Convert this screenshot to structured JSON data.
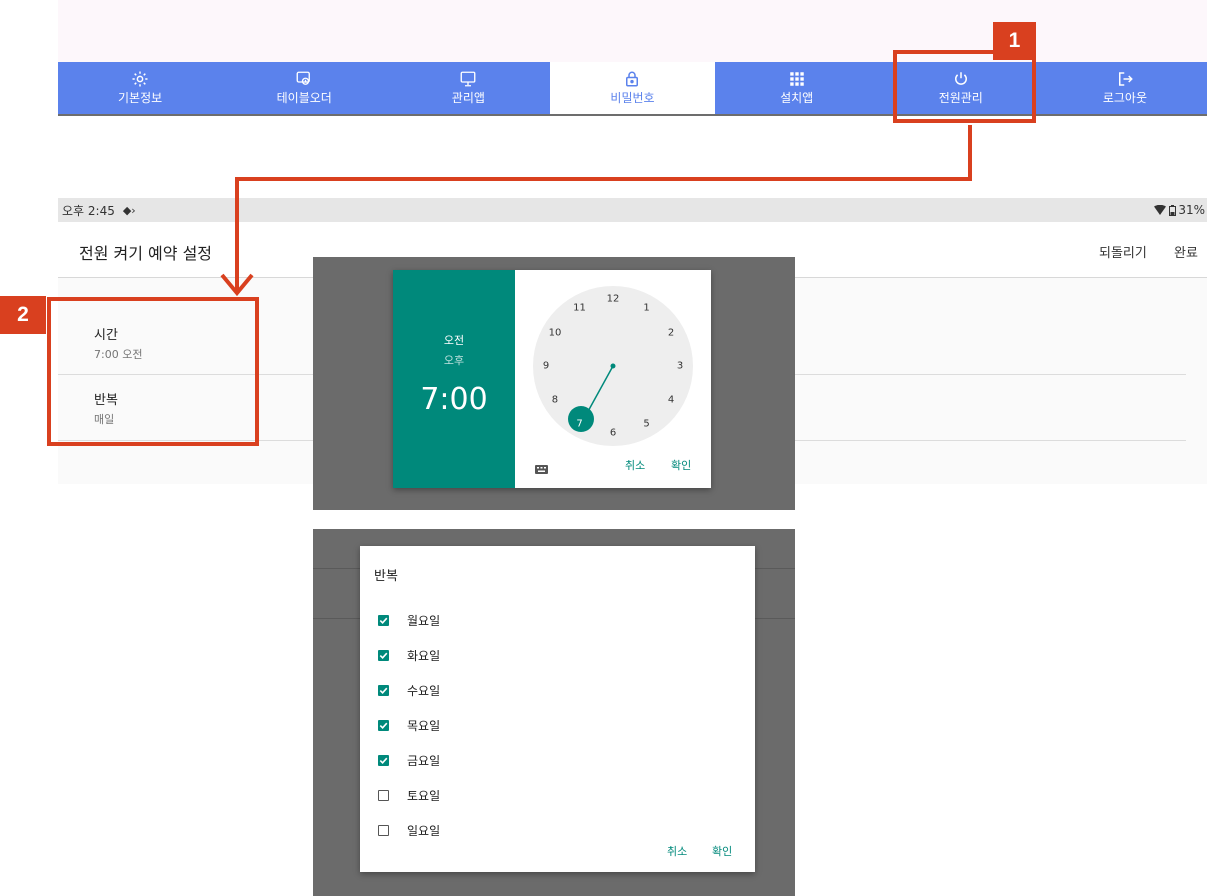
{
  "nav": {
    "items": [
      {
        "label": "기본정보",
        "icon": "gear-icon"
      },
      {
        "label": "테이블오더",
        "icon": "tablet-touch-icon"
      },
      {
        "label": "관리앱",
        "icon": "monitor-icon"
      },
      {
        "label": "비밀번호",
        "icon": "lock-icon"
      },
      {
        "label": "설치앱",
        "icon": "grid-icon"
      },
      {
        "label": "전원관리",
        "icon": "power-icon"
      },
      {
        "label": "로그아웃",
        "icon": "logout-icon"
      }
    ],
    "active": "비밀번호",
    "highlighted": "전원관리"
  },
  "annotations": {
    "badge1": "1",
    "badge2": "2"
  },
  "statusbar": {
    "time": "오후 2:45",
    "battery": "31%"
  },
  "settings": {
    "title": "전원 켜기 예약 설정",
    "revert_label": "되돌리기",
    "done_label": "완료",
    "time_title": "시간",
    "time_value": "7:00 오전",
    "repeat_title": "반복",
    "repeat_value": "매일"
  },
  "time_picker": {
    "am_label": "오전",
    "pm_label": "오후",
    "time": "7:00",
    "selected_hour": "7",
    "cancel_label": "취소",
    "ok_label": "확인",
    "hours": [
      "12",
      "1",
      "2",
      "3",
      "4",
      "5",
      "6",
      "7",
      "8",
      "9",
      "10",
      "11"
    ]
  },
  "repeat_dialog": {
    "title": "반복",
    "days": [
      {
        "label": "월요일",
        "checked": true
      },
      {
        "label": "화요일",
        "checked": true
      },
      {
        "label": "수요일",
        "checked": true
      },
      {
        "label": "목요일",
        "checked": true
      },
      {
        "label": "금요일",
        "checked": true
      },
      {
        "label": "토요일",
        "checked": false
      },
      {
        "label": "일요일",
        "checked": false
      }
    ],
    "cancel_label": "취소",
    "ok_label": "확인"
  },
  "colors": {
    "nav_blue": "#5b82ec",
    "teal": "#00897b",
    "annotation_red": "#d9401f",
    "overlay_gray": "#6b6b6b"
  }
}
